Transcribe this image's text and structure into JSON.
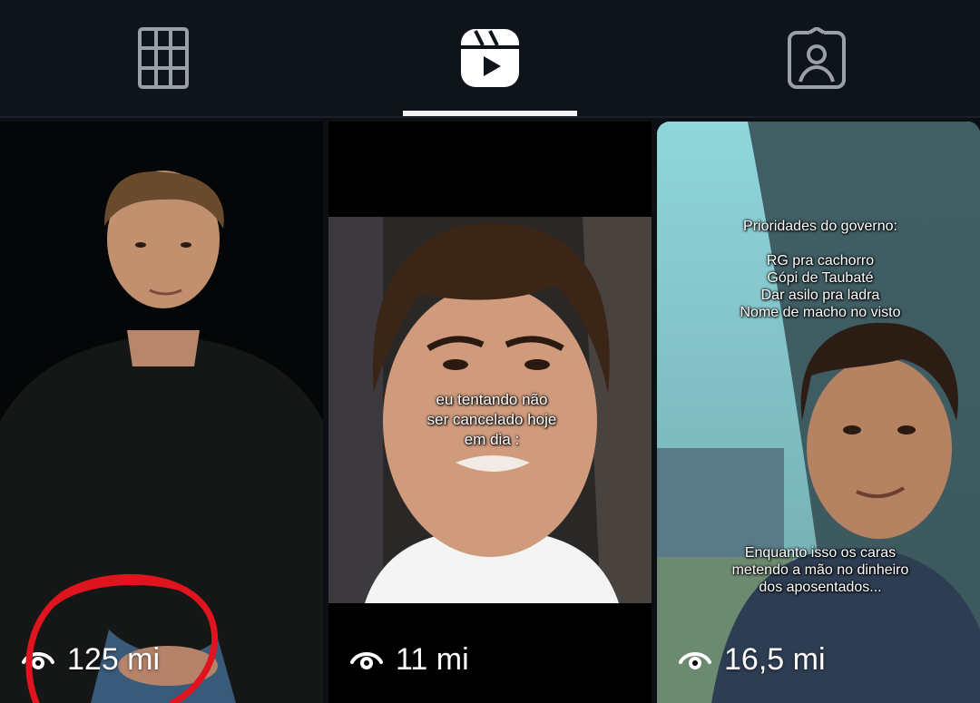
{
  "tabs": [
    {
      "icon": "grid-icon",
      "label": "Posts grid"
    },
    {
      "icon": "reels-icon",
      "label": "Reels",
      "active": true
    },
    {
      "icon": "tagged-person-icon",
      "label": "Tagged"
    }
  ],
  "reels": [
    {
      "views": "125 mi"
    },
    {
      "views": "11 mi",
      "caption": "eu tentando não\nser cancelado hoje\nem dia :"
    },
    {
      "views": "16,5 mi",
      "caption_top": "Prioridades do governo:\n\nRG pra cachorro\nGópi de Taubaté\nDar asilo pra ladra\nNome de macho no visto",
      "caption_bottom": "Enquanto isso os caras\nmetendo a mão no dinheiro\ndos aposentados..."
    }
  ],
  "colors": {
    "background": "#0c0f14",
    "active_tab": "#f2f2f2",
    "inactive_icon": "#9aa0a6",
    "annotation": "#e0141e"
  }
}
